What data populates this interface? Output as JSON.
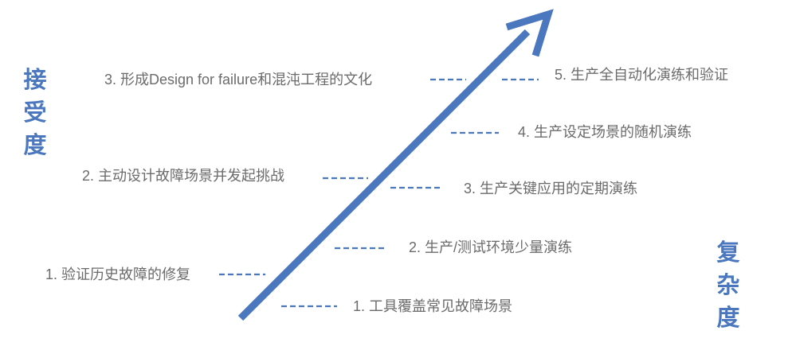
{
  "axes": {
    "vertical": "接受度",
    "horizontal": "复杂度"
  },
  "left_items": [
    "3. 形成Design for failure和混沌工程的文化",
    "2. 主动设计故障场景并发起挑战",
    "1. 验证历史故障的修复"
  ],
  "right_items": [
    "5. 生产全自动化演练和验证",
    "4. 生产设定场景的随机演练",
    "3. 生产关键应用的定期演练",
    "2. 生产/测试环境少量演练",
    "1. 工具覆盖常见故障场景"
  ],
  "colors": {
    "arrow": "#4a77bd",
    "dash": "#4a77bd",
    "label": "#6b6b6b",
    "axis_title": "#4a77bd"
  }
}
